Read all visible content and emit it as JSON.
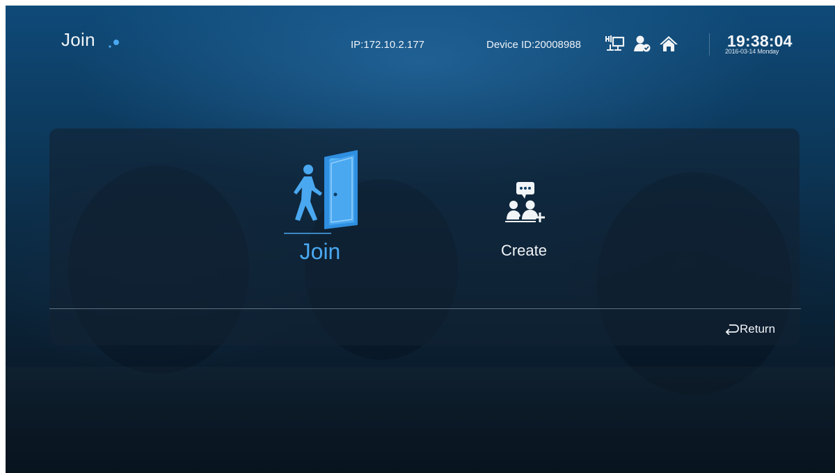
{
  "header": {
    "logo_text": "Join",
    "ip": "IP:172.10.2.177",
    "device_id": "Device ID:20008988",
    "time": "19:38:04",
    "date": "2016-03-14 Monday"
  },
  "status_icons": [
    "network-icon",
    "user-online-icon",
    "home-icon"
  ],
  "options": [
    {
      "label": "Join",
      "icon": "walk-through-door-icon",
      "selected": true
    },
    {
      "label": "Create",
      "icon": "create-meeting-icon",
      "selected": false
    }
  ],
  "footer": {
    "return_label": "Return",
    "return_icon": "return-arrow-icon"
  },
  "colors": {
    "accent": "#4aa8f0",
    "text": "#f0f4f8",
    "background": "#0d3d63"
  }
}
